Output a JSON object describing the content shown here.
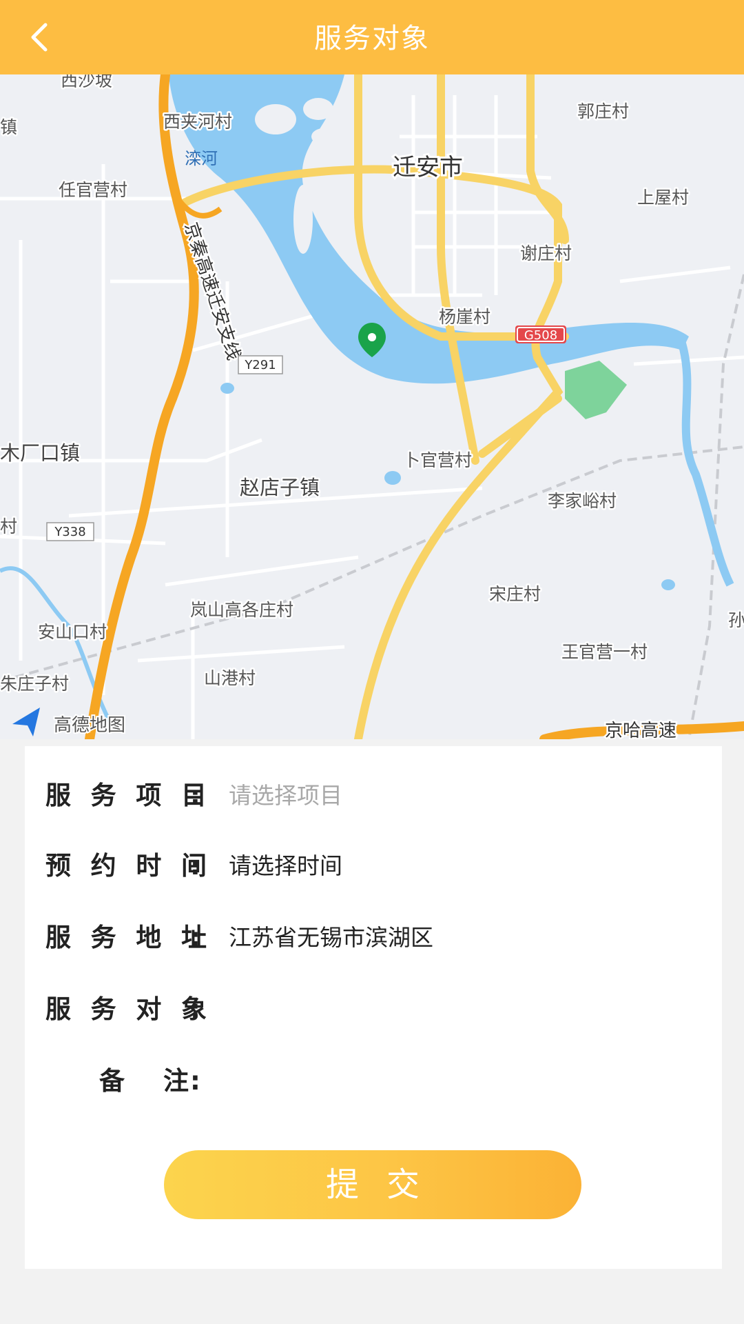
{
  "header": {
    "title": "服务对象",
    "back_icon": "chevron-left-icon",
    "background_color": "#fdbd42"
  },
  "map": {
    "provider_logo": "高德地图",
    "marker_icon": "location-pin-icon",
    "marker_color": "#1aa34a",
    "labels": {
      "xishapo": "西沙坡",
      "zhen_left": "镇",
      "xijiahecun": "西夹河村",
      "luanhe": "滦河",
      "qiananshi": "迁安市",
      "guozhuangcun": "郭庄村",
      "renguanyingcun": "任官营村",
      "shangwucun": "上屋村",
      "xiezhuangcun": "谢庄村",
      "yangyacun": "杨崖村",
      "g508": "G508",
      "y291": "Y291",
      "expressway": "京秦高速迁安支线",
      "muchangkouzhen": "木厂口镇",
      "buguanyingcun": "卜官营村",
      "zhaodianzizhen": "赵店子镇",
      "lijiayucun": "李家峪村",
      "cun_left": "村",
      "y338": "Y338",
      "songzhuangcun": "宋庄村",
      "lanshangaogezhuangcun": "岚山高各庄村",
      "anshankoucun": "安山口村",
      "sun": "孙",
      "wangguanyingyicun": "王官营一村",
      "zhuzhuangzicun": "朱庄子村",
      "shangangcun": "山港村",
      "jinghagaosu": "京哈高速"
    }
  },
  "form": {
    "rows": [
      {
        "label": "服务项目",
        "colon": ":",
        "value": "请选择项目"
      },
      {
        "label": "预约时间",
        "colon": ":",
        "value": "请选择时间"
      },
      {
        "label": "服务地址",
        "colon": ":",
        "value": "江苏省无锡市滨湖区"
      },
      {
        "label": "服务对象",
        "colon": ":",
        "value": ""
      },
      {
        "label": "备注",
        "colon": ":",
        "value": ""
      }
    ],
    "submit_label": "提交"
  }
}
